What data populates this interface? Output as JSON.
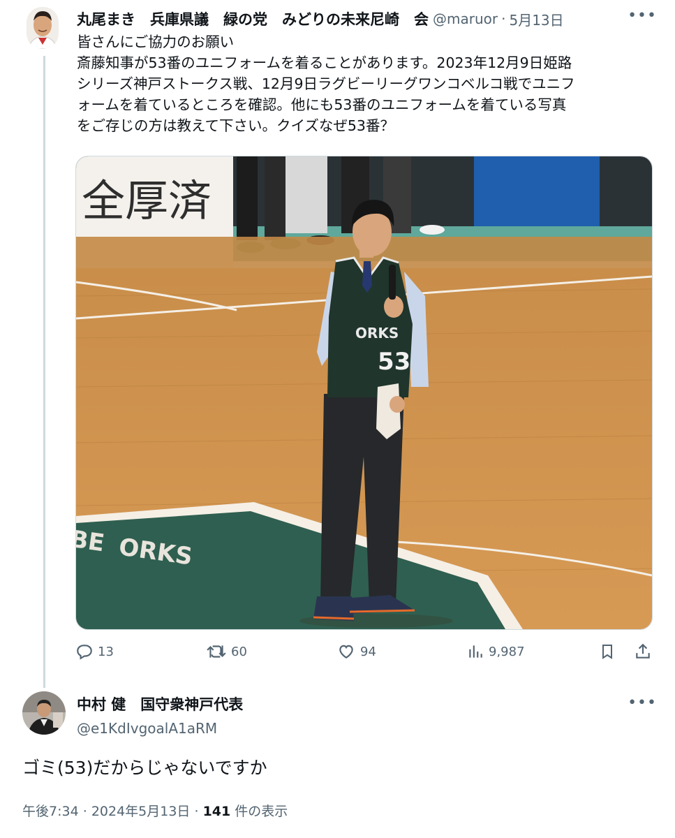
{
  "tweet": {
    "author_name": "丸尾まき　兵庫県議　緑の党　みどりの未来尼崎　会",
    "handle": "@maruor",
    "separator": "·",
    "date": "5月13日",
    "lines": [
      "皆さんにご協力のお願い",
      "斎藤知事が53番のユニフォームを着ることがあります。2023年12月9日姫路",
      "シリーズ神戸ストークス戦、12月9日ラグビーリーグワンコベルコ戦でユニフ",
      "ォームを着ているところを確認。他にも53番のユニフォームを着ている写真",
      "をご存じの方は教えて下さい。クイズなぜ53番？"
    ],
    "photo": {
      "banner_text": "全厚済",
      "jersey_line1": "ORKS",
      "jersey_number": "53",
      "court_text_1": "BE",
      "court_text_2": "ORKS"
    },
    "actions": {
      "replies": "13",
      "retweets": "60",
      "likes": "94",
      "views": "9,987"
    }
  },
  "reply": {
    "author_name": "中村 健　国守衆神戸代表",
    "handle": "@e1KdIvgoalA1aRM",
    "text": "ゴミ(53)だからじゃないですか",
    "time": "午後7:34",
    "dot": "·",
    "date": "2024年5月13日",
    "views_count": "141",
    "views_label": "件の表示"
  },
  "icons": [
    "reply-icon",
    "retweet-icon",
    "like-icon",
    "views-icon",
    "bookmark-icon",
    "share-icon",
    "more-icon"
  ],
  "colors": {
    "text": "#0f1419",
    "secondary": "#536471",
    "line": "#cfd9de"
  }
}
